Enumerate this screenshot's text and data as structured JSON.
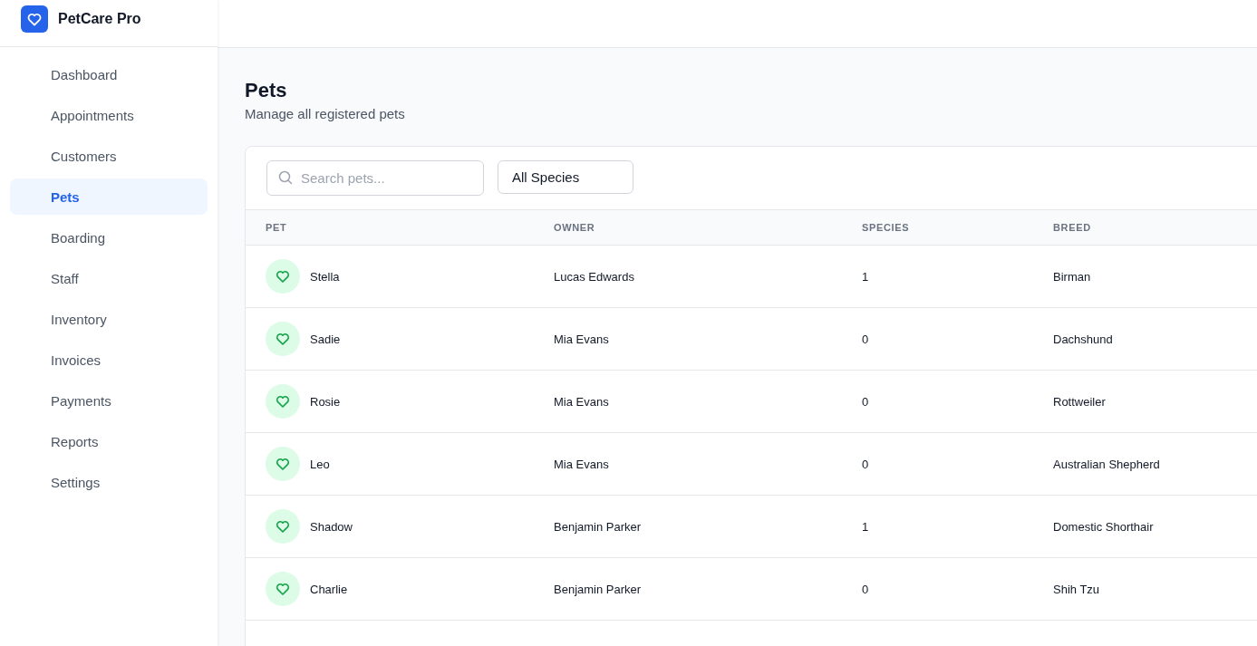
{
  "app": {
    "name": "PetCare Pro"
  },
  "sidebar": {
    "items": [
      {
        "label": "Dashboard",
        "selected": false
      },
      {
        "label": "Appointments",
        "selected": false
      },
      {
        "label": "Customers",
        "selected": false
      },
      {
        "label": "Pets",
        "selected": true
      },
      {
        "label": "Boarding",
        "selected": false
      },
      {
        "label": "Staff",
        "selected": false
      },
      {
        "label": "Inventory",
        "selected": false
      },
      {
        "label": "Invoices",
        "selected": false
      },
      {
        "label": "Payments",
        "selected": false
      },
      {
        "label": "Reports",
        "selected": false
      },
      {
        "label": "Settings",
        "selected": false
      }
    ]
  },
  "page": {
    "title": "Pets",
    "subtitle": "Manage all registered pets"
  },
  "filters": {
    "search": {
      "placeholder": "Search pets..."
    },
    "species": {
      "value": "All Species"
    }
  },
  "table": {
    "columns": [
      "PET",
      "OWNER",
      "SPECIES",
      "BREED"
    ],
    "rows": [
      {
        "pet": "Stella",
        "owner": "Lucas Edwards",
        "species": "1",
        "breed": "Birman"
      },
      {
        "pet": "Sadie",
        "owner": "Mia Evans",
        "species": "0",
        "breed": "Dachshund"
      },
      {
        "pet": "Rosie",
        "owner": "Mia Evans",
        "species": "0",
        "breed": "Rottweiler"
      },
      {
        "pet": "Leo",
        "owner": "Mia Evans",
        "species": "0",
        "breed": "Australian Shepherd"
      },
      {
        "pet": "Shadow",
        "owner": "Benjamin Parker",
        "species": "1",
        "breed": "Domestic Shorthair"
      },
      {
        "pet": "Charlie",
        "owner": "Benjamin Parker",
        "species": "0",
        "breed": "Shih Tzu"
      }
    ]
  }
}
